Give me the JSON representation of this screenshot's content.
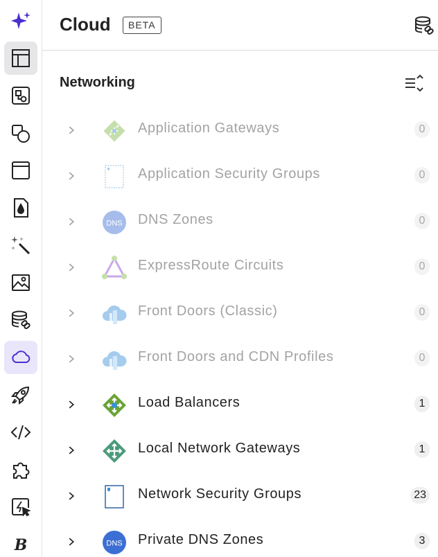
{
  "header": {
    "title": "Cloud",
    "badge": "BETA"
  },
  "section": {
    "title": "Networking"
  },
  "rows": [
    {
      "label": "Application Gateways",
      "count": "0",
      "icon": "application-gateway-icon",
      "dim": true
    },
    {
      "label": "Application Security Groups",
      "count": "0",
      "icon": "application-security-group-icon",
      "dim": true
    },
    {
      "label": "DNS Zones",
      "count": "0",
      "icon": "dns-zone-icon",
      "dim": true,
      "icon_text": "DNS"
    },
    {
      "label": "ExpressRoute Circuits",
      "count": "0",
      "icon": "expressroute-icon",
      "dim": true
    },
    {
      "label": "Front Doors (Classic)",
      "count": "0",
      "icon": "front-door-icon",
      "dim": true
    },
    {
      "label": "Front Doors and CDN Profiles",
      "count": "0",
      "icon": "front-door-cdn-icon",
      "dim": true
    },
    {
      "label": "Load Balancers",
      "count": "1",
      "icon": "load-balancer-icon",
      "dim": false
    },
    {
      "label": "Local Network Gateways",
      "count": "1",
      "icon": "local-network-gateway-icon",
      "dim": false
    },
    {
      "label": "Network Security Groups",
      "count": "23",
      "icon": "network-security-group-icon",
      "dim": false
    },
    {
      "label": "Private DNS Zones",
      "count": "3",
      "icon": "private-dns-zone-icon",
      "dim": false,
      "icon_text": "DNS"
    }
  ],
  "rail": [
    "sparkle-icon",
    "layout-icon",
    "shapes-icon",
    "objects-icon",
    "window-icon",
    "drop-file-icon",
    "magic-wand-icon",
    "image-icon",
    "database-link-icon",
    "cloud-icon",
    "rocket-icon",
    "code-icon",
    "puzzle-icon",
    "lightning-cursor-icon",
    "brand-b-icon"
  ],
  "colors": {
    "accent": "#5b3fd6",
    "cloud_active_bg": "#e9e6fb",
    "active_bg": "#e6e6e9"
  }
}
